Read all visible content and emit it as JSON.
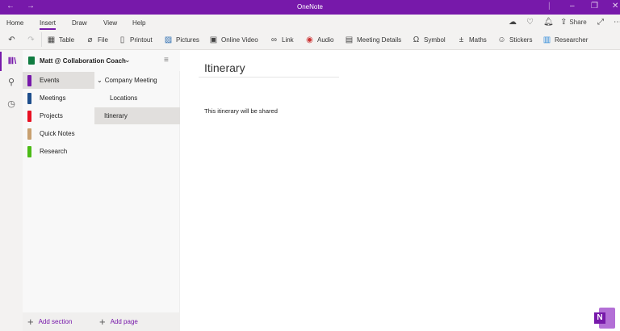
{
  "window": {
    "title": "OneNote",
    "back_icon": "←",
    "forward_icon": "→"
  },
  "menu": {
    "tabs": [
      "Home",
      "Insert",
      "Draw",
      "View",
      "Help"
    ],
    "active": "Insert",
    "share": "Share"
  },
  "toolbar": {
    "items": [
      "Table",
      "File",
      "Printout",
      "Pictures",
      "Online Video",
      "Link",
      "Audio",
      "Meeting Details",
      "Symbol",
      "Maths",
      "Stickers",
      "Researcher"
    ]
  },
  "notebook": {
    "name": "Matt @ Collaboration Coach"
  },
  "sections": [
    {
      "label": "Events",
      "color": "#7719aa"
    },
    {
      "label": "Meetings",
      "color": "#1e4e8c"
    },
    {
      "label": "Projects",
      "color": "#e81123"
    },
    {
      "label": "Quick Notes",
      "color": "#c8a070"
    },
    {
      "label": "Research",
      "color": "#4cbb17"
    }
  ],
  "pages": [
    {
      "label": "Company Meeting",
      "chevron": "⌄"
    },
    {
      "label": "Locations"
    },
    {
      "label": "Itinerary"
    }
  ],
  "footer": {
    "add_section": "Add section",
    "add_page": "Add page"
  },
  "page": {
    "title": "Itinerary",
    "body": "This itinerary will be shared"
  },
  "logo": {
    "letter": "N"
  }
}
